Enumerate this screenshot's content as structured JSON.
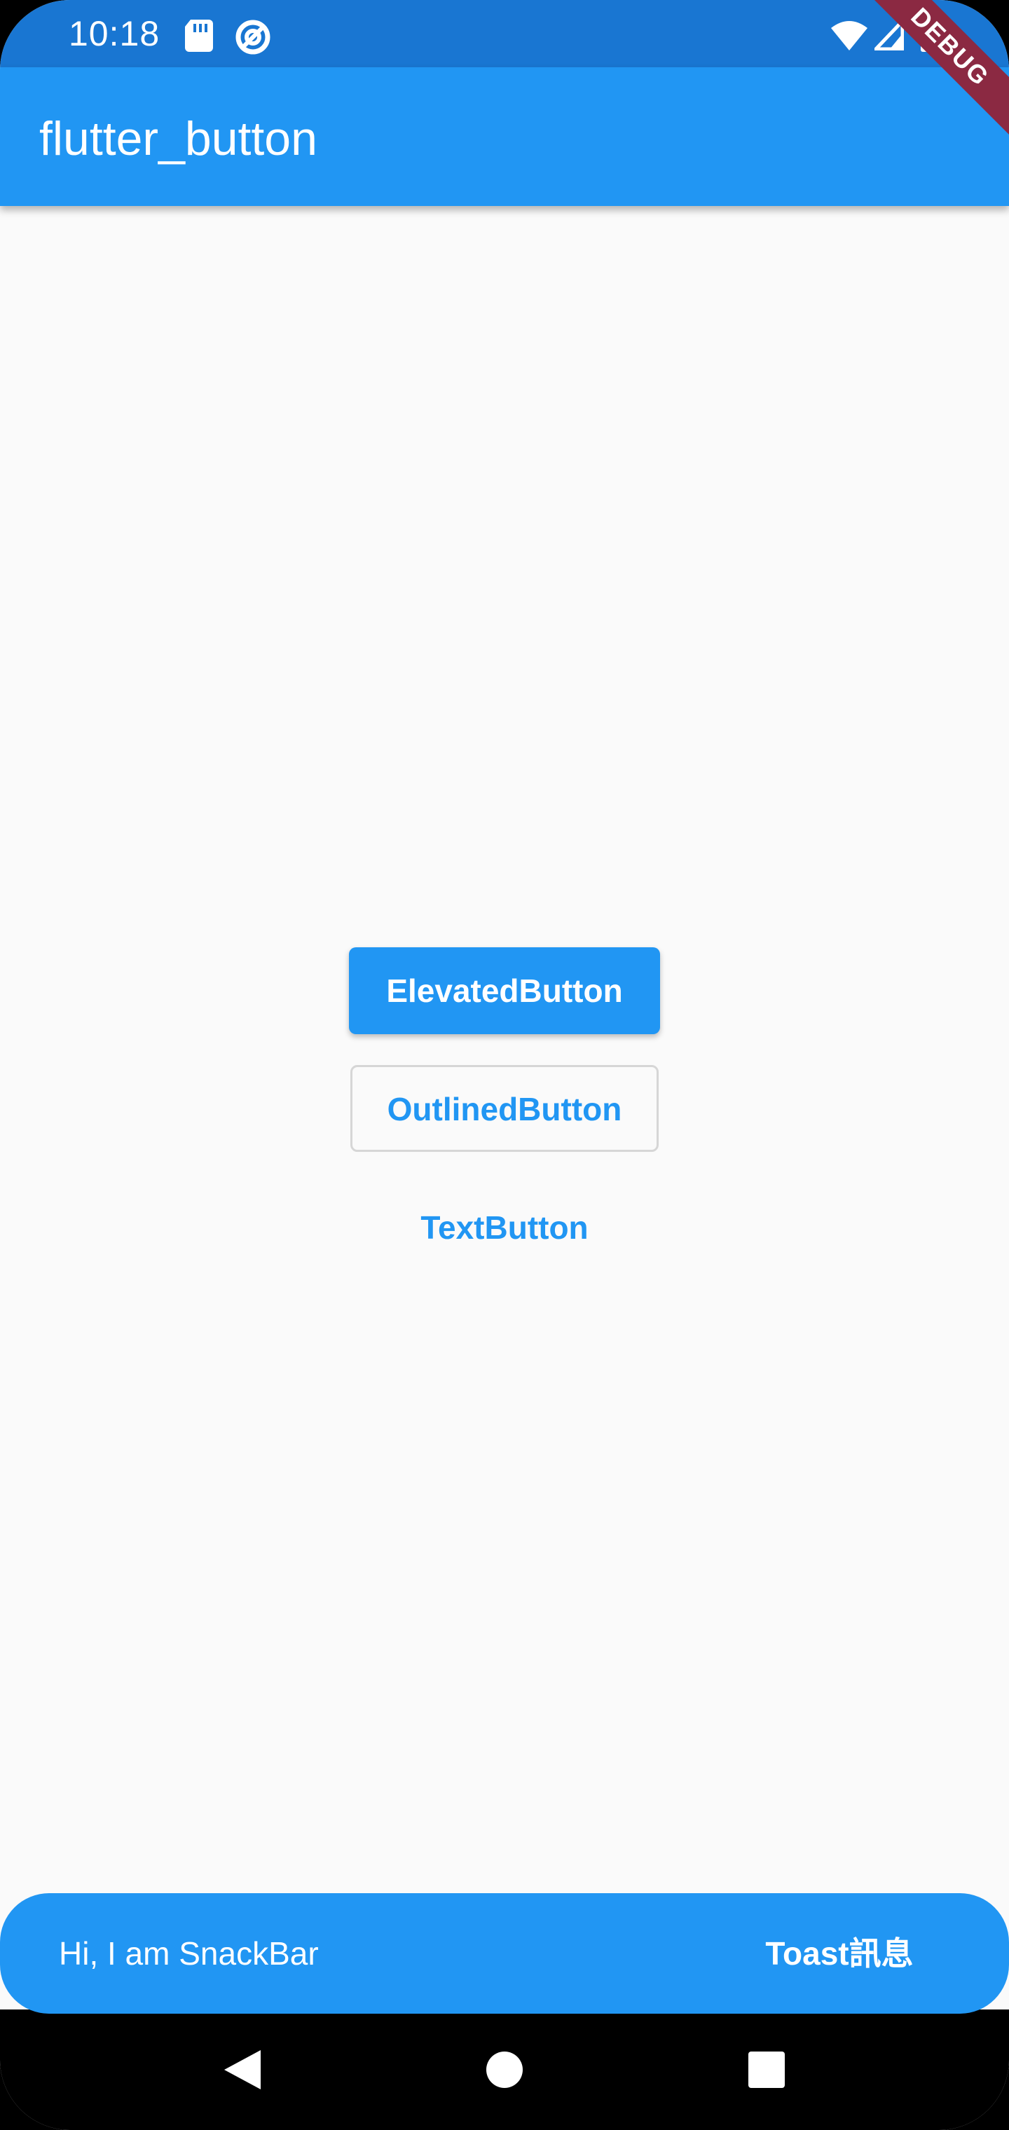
{
  "status_bar": {
    "time": "10:18",
    "left_icons": [
      "sd-card-icon",
      "data-saver-icon"
    ],
    "right_icons": [
      "wifi-icon",
      "cell-signal-icon",
      "battery-icon"
    ],
    "background_color": "#1976d2"
  },
  "app_bar": {
    "title": "flutter_button",
    "background_color": "#2196f3"
  },
  "debug_banner": {
    "label": "DEBUG",
    "color": "#8b2942"
  },
  "buttons": {
    "elevated_label": "ElevatedButton",
    "outlined_label": "OutlinedButton",
    "text_label": "TextButton",
    "accent_color": "#2196f3"
  },
  "snackbar": {
    "message": "Hi, I am SnackBar",
    "action_label": "Toast訊息",
    "background_color": "#2196f3"
  },
  "nav_bar": {
    "icons": [
      "back-icon",
      "home-icon",
      "recents-icon"
    ]
  }
}
